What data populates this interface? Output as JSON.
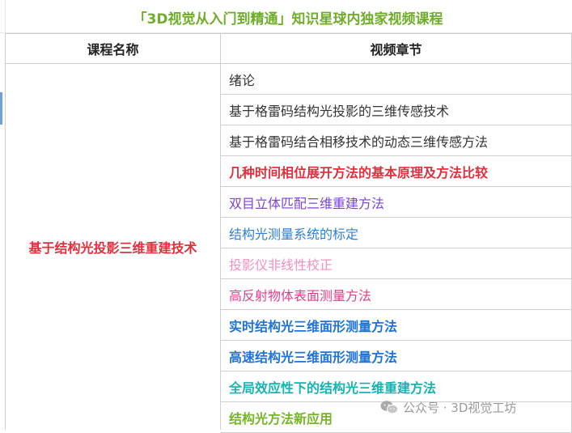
{
  "title": "「3D视觉从入门到精通」知识星球内独家视频课程",
  "headers": {
    "course": "课程名称",
    "chapters": "视频章节"
  },
  "course_name": "基于结构光投影三维重建技术",
  "chapters": [
    {
      "text": "绪论",
      "color": "#333333",
      "bold": false
    },
    {
      "text": "基于格雷码结构光投影的三维传感技术",
      "color": "#333333",
      "bold": false
    },
    {
      "text": "基于格雷码结合相移技术的动态三维传感方法",
      "color": "#333333",
      "bold": false
    },
    {
      "text": "几种时间相位展开方法的基本原理及方法比较",
      "color": "#e0303e",
      "bold": true
    },
    {
      "text": "双目立体匹配三维重建方法",
      "color": "#7b43d8",
      "bold": false
    },
    {
      "text": "结构光测量系统的标定",
      "color": "#2f7fd3",
      "bold": false
    },
    {
      "text": "投影仪非线性校正",
      "color": "#f38fc3",
      "bold": false
    },
    {
      "text": "高反射物体表面测量方法",
      "color": "#e23d8c",
      "bold": false
    },
    {
      "text": "实时结构光三维面形测量方法",
      "color": "#1f73d6",
      "bold": true
    },
    {
      "text": "高速结构光三维面形测量方法",
      "color": "#1f73d6",
      "bold": true
    },
    {
      "text": "全局效应性下的结构光三维重建方法",
      "color": "#17b3b1",
      "bold": true
    },
    {
      "text": "结构光方法新应用",
      "color": "#77b52a",
      "bold": true
    }
  ],
  "watermark": {
    "text": "公众号 · 3D视觉工坊",
    "icon": "wechat-icon"
  }
}
